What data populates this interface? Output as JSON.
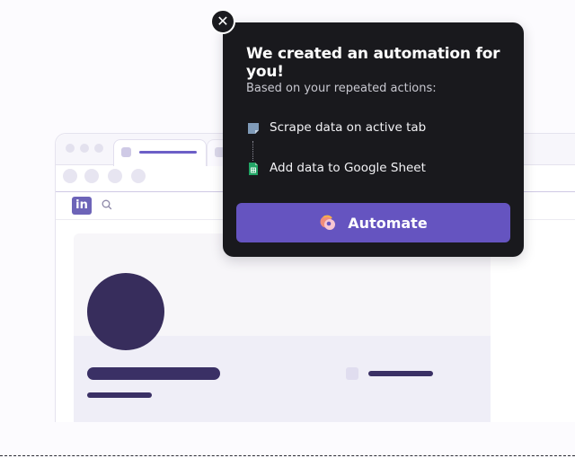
{
  "popup": {
    "title": "We created an automation for you!",
    "subtitle": "Based on your repeated actions:",
    "steps": [
      {
        "label": "Scrape data on active tab",
        "icon": "scrape-icon"
      },
      {
        "label": "Add data to Google Sheet",
        "icon": "google-sheets-icon"
      }
    ],
    "automate_label": "Automate",
    "close_symbol": "✕"
  },
  "browser": {
    "site_logo_text": "in"
  },
  "colors": {
    "accent": "#6554c0",
    "popup_bg": "#19191d",
    "avatar": "#372d5c"
  }
}
